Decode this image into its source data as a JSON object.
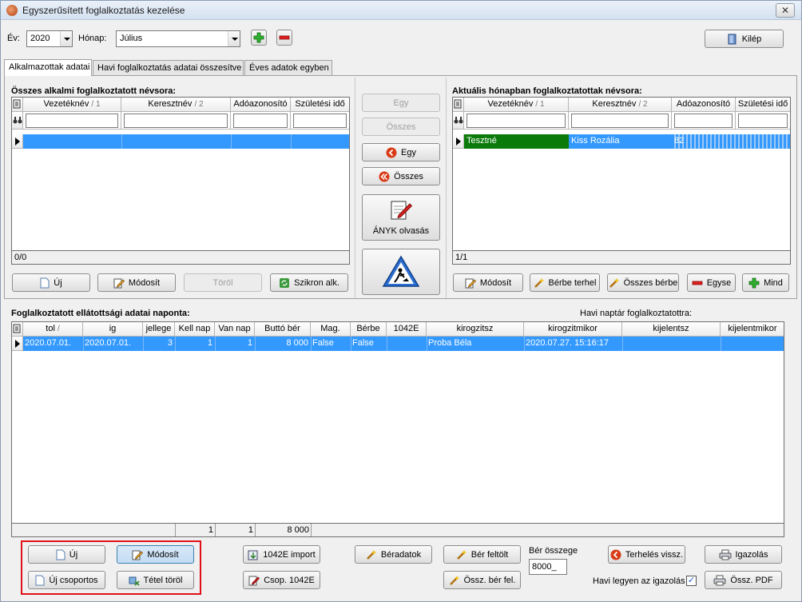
{
  "window": {
    "title": "Egyszerűsített foglalkoztatás kezelése",
    "close": "✕"
  },
  "topbar": {
    "year_label": "Év:",
    "year_value": "2020",
    "month_label": "Hónap:",
    "month_value": "Július",
    "exit_label": "Kilép"
  },
  "tabs": [
    "Alkalmazottak adatai",
    "Havi foglalkoztatás adatai összesítve",
    "Éves adatok egyben"
  ],
  "left_panel": {
    "title": "Összes alkalmi foglalkoztatott névsora:",
    "headers": [
      "Vezetéknév",
      "Keresztnév",
      "Adóazonosító",
      "Születési idő"
    ],
    "sort_marks": [
      "1",
      "2"
    ],
    "status": "0/0",
    "buttons": {
      "new": "Új",
      "modify": "Módosít",
      "delete": "Töröl",
      "sync": "Szikron alk."
    }
  },
  "middle_buttons": {
    "one_disabled": "Egy",
    "all_disabled": "Összes",
    "one": "Egy",
    "all": "Összes",
    "anyk": "ÁNYK olvasás"
  },
  "right_panel": {
    "title": "Aktuális hónapban foglalkoztatottak névsora:",
    "headers": [
      "Vezetéknév",
      "Keresztnév",
      "Adóazonosító",
      "Születési idő"
    ],
    "sort_marks": [
      "1",
      "2"
    ],
    "row": {
      "last": "Tesztné",
      "first": "Kiss Rozália",
      "tax": "82",
      "birth": ""
    },
    "status": "1/1",
    "buttons": {
      "modify": "Módosít",
      "rent": "Bérbe terhel",
      "all_rent": "Összes bérbe",
      "one": "Egyse",
      "all": "Mind"
    }
  },
  "daily": {
    "title": "Foglalkoztatott ellátottsági adatai naponta:",
    "calendar_label": "Havi naptár foglalkoztatottra:",
    "headers": [
      "tol",
      "ig",
      "jellege",
      "Kell nap",
      "Van nap",
      "Buttó bér",
      "Mag.",
      "Bérbe",
      "1042E",
      "kirogzitsz",
      "kirogzitmikor",
      "kijelentsz",
      "kijelentmikor"
    ],
    "rows": [
      {
        "tol": "2020.07.01.",
        "ig": "2020.07.01.",
        "jellege": "3",
        "kell": "1",
        "van": "1",
        "brutto": "8 000",
        "mag": "False",
        "berbe": "False",
        "e1042": "",
        "kirogzitsz": "Proba Béla",
        "kirogzitmikor": "2020.07.27. 15:16:17",
        "kijelentsz": "",
        "kijelentmikor": ""
      }
    ],
    "totals": {
      "kell": "1",
      "van": "1",
      "brutto": "8 000"
    }
  },
  "bottom": {
    "new": "Új",
    "modify": "Módosít",
    "new_group": "Új csoportos",
    "delete_item": "Tétel töröl",
    "import": "1042E import",
    "group_1042": "Csop. 1042E",
    "wage_data": "Béradatok",
    "wage_upload": "Bér feltölt",
    "sum_wage_upload": "Össz. bér fel.",
    "wage_sum_label": "Bér összege",
    "wage_sum_value": "8000_",
    "charge_back": "Terhelés vissz.",
    "certificate": "Igazolás",
    "sum_pdf": "Össz. PDF",
    "monthly_cert_label": "Havi legyen az igazolás",
    "monthly_cert_checked": "✓"
  },
  "colors": {
    "selection": "#3399ff",
    "green_row": "#0a7a0a",
    "highlight_box": "#e0101a"
  }
}
